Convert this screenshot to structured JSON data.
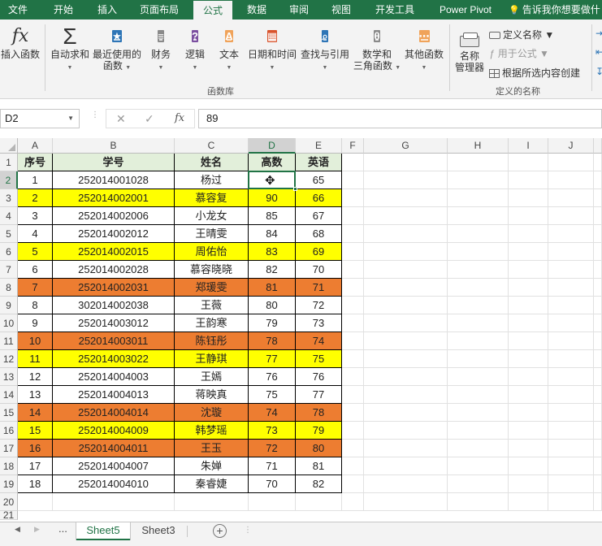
{
  "tabs": [
    "文件",
    "开始",
    "插入",
    "页面布局",
    "公式",
    "数据",
    "审阅",
    "视图",
    "开发工具",
    "Power Pivot",
    "告诉我你想要做什"
  ],
  "ribbon": {
    "insert_function": "插入函数",
    "autosum": "自动求和",
    "recent_1": "最近使用的",
    "recent_2": "函数",
    "financial": "财务",
    "logical": "逻辑",
    "text": "文本",
    "datetime": "日期和时间",
    "lookup": "查找与引用",
    "math_1": "数学和",
    "math_2": "三角函数",
    "more": "其他函数",
    "name_mgr_1": "名称",
    "name_mgr_2": "管理器",
    "define_name": "定义名称",
    "use_in_formula": "用于公式",
    "create_from_sel": "根据所选内容创建",
    "group_function_library": "函数库",
    "group_defined_names": "定义的名称"
  },
  "formula_bar": {
    "name_box": "D2",
    "fx": "fx",
    "value": "89"
  },
  "columns": [
    "A",
    "B",
    "C",
    "D",
    "E",
    "F",
    "G",
    "H",
    "I",
    "J"
  ],
  "headers": [
    "序号",
    "学号",
    "姓名",
    "高数",
    "英语"
  ],
  "rows": [
    {
      "no": "1",
      "id": "252014001028",
      "name": "杨过",
      "math": "",
      "eng": "65",
      "fill": "none"
    },
    {
      "no": "2",
      "id": "252014002001",
      "name": "慕容复",
      "math": "90",
      "eng": "66",
      "fill": "yellow"
    },
    {
      "no": "3",
      "id": "252014002006",
      "name": "小龙女",
      "math": "85",
      "eng": "67",
      "fill": "none"
    },
    {
      "no": "4",
      "id": "252014002012",
      "name": "王晴雯",
      "math": "84",
      "eng": "68",
      "fill": "none"
    },
    {
      "no": "5",
      "id": "252014002015",
      "name": "周佑怡",
      "math": "83",
      "eng": "69",
      "fill": "yellow"
    },
    {
      "no": "6",
      "id": "252014002028",
      "name": "慕容晓晓",
      "math": "82",
      "eng": "70",
      "fill": "none"
    },
    {
      "no": "7",
      "id": "252014002031",
      "name": "郑瑗雯",
      "math": "81",
      "eng": "71",
      "fill": "orange"
    },
    {
      "no": "8",
      "id": "302014002038",
      "name": "王薇",
      "math": "80",
      "eng": "72",
      "fill": "none"
    },
    {
      "no": "9",
      "id": "252014003012",
      "name": "王韵寒",
      "math": "79",
      "eng": "73",
      "fill": "none"
    },
    {
      "no": "10",
      "id": "252014003011",
      "name": "陈钰彤",
      "math": "78",
      "eng": "74",
      "fill": "orange"
    },
    {
      "no": "11",
      "id": "252014003022",
      "name": "王静琪",
      "math": "77",
      "eng": "75",
      "fill": "yellow"
    },
    {
      "no": "12",
      "id": "252014004003",
      "name": "王嫣",
      "math": "76",
      "eng": "76",
      "fill": "none"
    },
    {
      "no": "13",
      "id": "252014004013",
      "name": "蒋映真",
      "math": "75",
      "eng": "77",
      "fill": "none"
    },
    {
      "no": "14",
      "id": "252014004014",
      "name": "沈璇",
      "math": "74",
      "eng": "78",
      "fill": "orange"
    },
    {
      "no": "15",
      "id": "252014004009",
      "name": "韩梦瑶",
      "math": "73",
      "eng": "79",
      "fill": "yellow"
    },
    {
      "no": "16",
      "id": "252014004011",
      "name": "王玉",
      "math": "72",
      "eng": "80",
      "fill": "orange"
    },
    {
      "no": "17",
      "id": "252014004007",
      "name": "朱婵",
      "math": "71",
      "eng": "81",
      "fill": "none"
    },
    {
      "no": "18",
      "id": "252014004010",
      "name": "秦睿婕",
      "math": "70",
      "eng": "82",
      "fill": "none"
    }
  ],
  "colors": {
    "yellow": "#ffff00",
    "orange": "#ed7d31",
    "accent": "#217346",
    "header_fill": "#e2efda"
  },
  "sheets": [
    "Sheet5",
    "Sheet3"
  ],
  "sheet_nav": {
    "more": "..."
  }
}
